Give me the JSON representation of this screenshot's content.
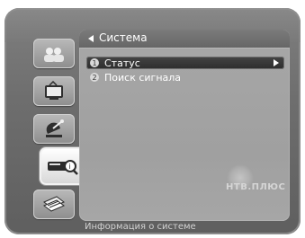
{
  "header": {
    "title": "Система"
  },
  "menu": {
    "items": [
      {
        "number": "1",
        "label": "Статус",
        "selected": true
      },
      {
        "number": "2",
        "label": "Поиск сигнала",
        "selected": false
      }
    ]
  },
  "brand": {
    "text": "НТВ.ПЛЮС"
  },
  "footer": {
    "hint": "Информация о системе"
  },
  "sidebar": {
    "items": [
      {
        "icon": "users-icon",
        "active": false
      },
      {
        "icon": "tv-guide-icon",
        "active": false
      },
      {
        "icon": "satellite-icon",
        "active": false
      },
      {
        "icon": "system-info-icon",
        "active": true
      },
      {
        "icon": "settings-stack-icon",
        "active": false
      }
    ]
  },
  "colors": {
    "frame": "#6e6e6e",
    "panel": "#a7a7a7",
    "selected_row": "#333333",
    "text": "#ffffff"
  }
}
